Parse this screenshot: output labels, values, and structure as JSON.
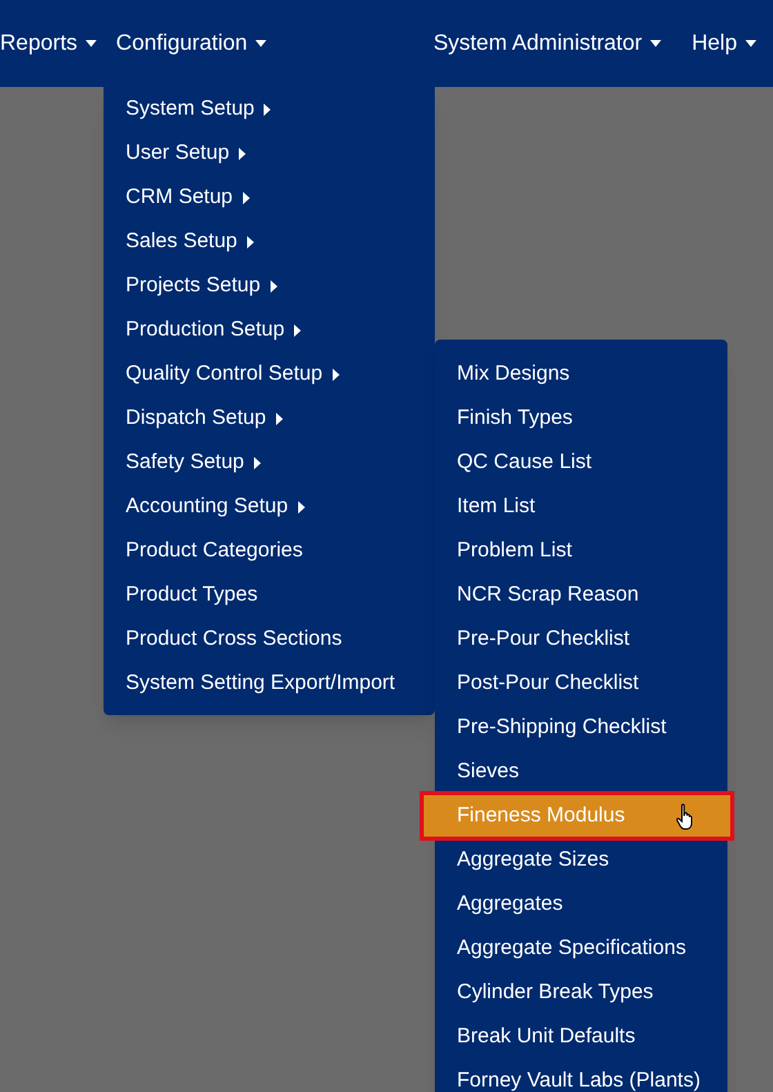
{
  "navbar": {
    "left": [
      {
        "label": "Reports"
      },
      {
        "label": "Configuration"
      }
    ],
    "right": [
      {
        "label": "System Administrator"
      },
      {
        "label": "Help"
      }
    ]
  },
  "config_menu": {
    "items": [
      {
        "label": "System Setup",
        "kind": "submenu"
      },
      {
        "label": "User Setup",
        "kind": "submenu"
      },
      {
        "label": "CRM Setup",
        "kind": "submenu"
      },
      {
        "label": "Sales Setup",
        "kind": "submenu"
      },
      {
        "label": "Projects Setup",
        "kind": "submenu"
      },
      {
        "label": "Production Setup",
        "kind": "submenu"
      },
      {
        "label": "Quality Control Setup",
        "kind": "submenu"
      },
      {
        "label": "Dispatch Setup",
        "kind": "submenu"
      },
      {
        "label": "Safety Setup",
        "kind": "submenu"
      },
      {
        "label": "Accounting Setup",
        "kind": "submenu"
      },
      {
        "label": "Product Categories",
        "kind": "link"
      },
      {
        "label": "Product Types",
        "kind": "link"
      },
      {
        "label": "Product Cross Sections",
        "kind": "link"
      },
      {
        "label": "System Setting Export/Import",
        "kind": "link"
      }
    ]
  },
  "quality_control_submenu": {
    "items": [
      {
        "label": "Mix Designs",
        "selected": false,
        "outlined": false
      },
      {
        "label": "Finish Types",
        "selected": false,
        "outlined": false
      },
      {
        "label": "QC Cause List",
        "selected": false,
        "outlined": false
      },
      {
        "label": "Item List",
        "selected": false,
        "outlined": false
      },
      {
        "label": "Problem List",
        "selected": false,
        "outlined": false
      },
      {
        "label": "NCR Scrap Reason",
        "selected": false,
        "outlined": false
      },
      {
        "label": "Pre-Pour Checklist",
        "selected": false,
        "outlined": false
      },
      {
        "label": "Post-Pour Checklist",
        "selected": false,
        "outlined": false
      },
      {
        "label": "Pre-Shipping Checklist",
        "selected": false,
        "outlined": false
      },
      {
        "label": "Sieves",
        "selected": false,
        "outlined": false
      },
      {
        "label": "Fineness Modulus",
        "selected": true,
        "outlined": true
      },
      {
        "label": "Aggregate Sizes",
        "selected": false,
        "outlined": false
      },
      {
        "label": "Aggregates",
        "selected": false,
        "outlined": false
      },
      {
        "label": "Aggregate Specifications",
        "selected": false,
        "outlined": false
      },
      {
        "label": "Cylinder Break Types",
        "selected": false,
        "outlined": false
      },
      {
        "label": "Break Unit Defaults",
        "selected": false,
        "outlined": false
      },
      {
        "label": "Forney Vault Labs (Plants)",
        "selected": false,
        "outlined": false
      }
    ]
  }
}
